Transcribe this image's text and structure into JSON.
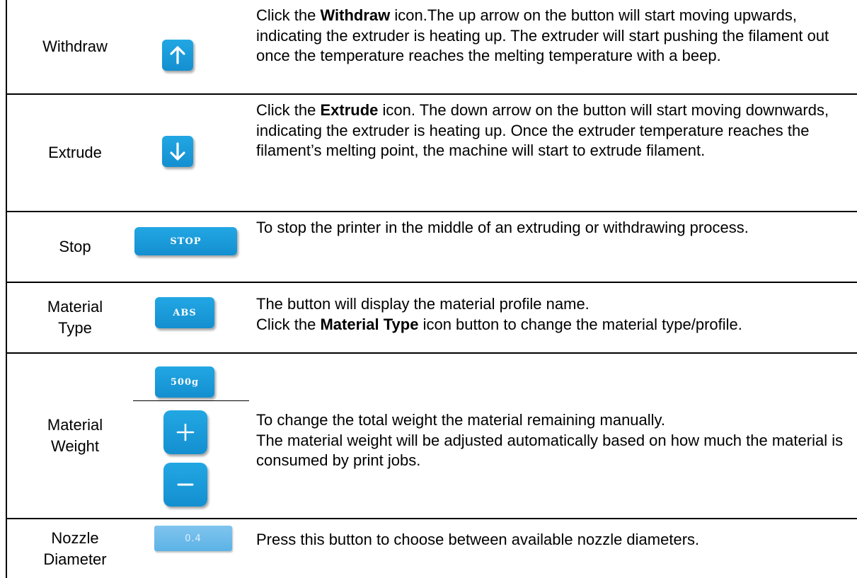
{
  "rows": {
    "withdraw": {
      "name": "Withdraw",
      "desc_a": "Click the ",
      "desc_bold": "Withdraw",
      "desc_b": " icon.The up arrow on the button will start moving upwards, indicating the extruder is heating up. The extruder will start pushing the filament out once the temperature reaches the melting temperature with a beep.",
      "icon": "arrow-up-icon"
    },
    "extrude": {
      "name": "Extrude",
      "desc_a": "Click the ",
      "desc_bold": "Extrude",
      "desc_b": " icon. The down arrow on the button will start moving downwards, indicating the extruder is heating up. Once the extruder temperature reaches the filament’s melting point, the machine will start to extrude filament.",
      "icon": "arrow-down-icon"
    },
    "stop": {
      "name": "Stop",
      "button_label": "STOP",
      "desc": "To stop the printer in the middle of an extruding or withdrawing process."
    },
    "material_type": {
      "name": "Material\nType",
      "button_label": "ABS",
      "desc_line1": "The button will display the material profile name.",
      "desc_a": "Click the ",
      "desc_bold": "Material Type",
      "desc_b": " icon button to change the material type/profile."
    },
    "material_weight": {
      "name": "Material\nWeight",
      "button_label": "500g",
      "plus_icon": "plus-icon",
      "minus_icon": "minus-icon",
      "desc_line1": "To change the total weight the material remaining manually.",
      "desc_line2": "The material weight will be adjusted  automatically based on how much the material is consumed by print jobs."
    },
    "nozzle": {
      "name": "Nozzle\nDiameter",
      "button_label": "0.4",
      "desc": "Press this button to choose between available nozzle diameters."
    }
  },
  "colors": {
    "button_blue": "#1a9ad8",
    "nozzle_blue": "#6cbbe9",
    "border": "#000000"
  }
}
